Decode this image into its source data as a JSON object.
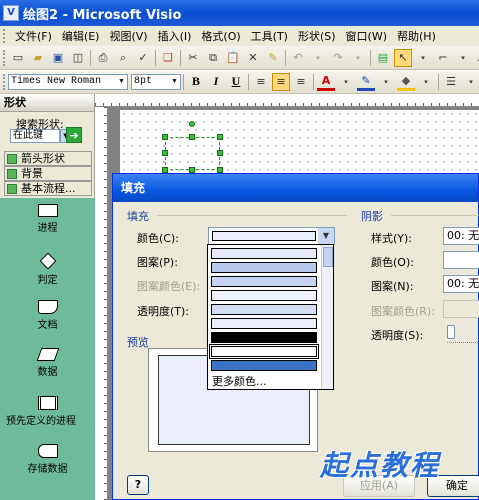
{
  "window": {
    "title": "绘图2 - Microsoft Visio",
    "app_icon": "V"
  },
  "menu": [
    "文件(F)",
    "编辑(E)",
    "视图(V)",
    "插入(I)",
    "格式(O)",
    "工具(T)",
    "形状(S)",
    "窗口(W)",
    "帮助(H)"
  ],
  "format_toolbar": {
    "font": "Times New Roman",
    "size": "8pt",
    "bold": "B",
    "italic": "I",
    "underline": "U"
  },
  "shapes_panel": {
    "title": "形状",
    "search_label": "搜索形状:",
    "search_scope": "在此键",
    "stencils": [
      "箭头形状",
      "背景",
      "基本流程..."
    ],
    "shapes": [
      "进程",
      "判定",
      "文档",
      "数据",
      "预先定义的进程",
      "存储数据"
    ]
  },
  "fill_dialog": {
    "title": "填充",
    "fill_group": "填充",
    "color_label": "颜色(C):",
    "pattern_label": "图案(P):",
    "pattern_color_label": "图案颜色(E):",
    "transparency_label": "透明度(T):",
    "preview_label": "预览",
    "shadow_group": "阴影",
    "shadow_style_label": "样式(Y):",
    "shadow_style_value": "00: 无",
    "shadow_color_label": "颜色(O):",
    "shadow_pattern_label": "图案(N):",
    "shadow_pattern_value": "00: 无",
    "shadow_pattern_color_label": "图案颜色(R):",
    "shadow_transparency_label": "透明度(S):",
    "more_colors": "更多颜色...",
    "help_icon": "?",
    "apply_button": "应用(A)",
    "ok_button": "确定",
    "colors": {
      "preview_fill": "#e9eef8",
      "swatches": [
        "#e6ecf7",
        "#b7c9ea",
        "#c7d4ee",
        "#eef3fb",
        "#d3def3",
        "#e9eef8",
        "#000000",
        "#ffffff",
        "#3e72c4"
      ]
    }
  },
  "watermark": "起点教程"
}
